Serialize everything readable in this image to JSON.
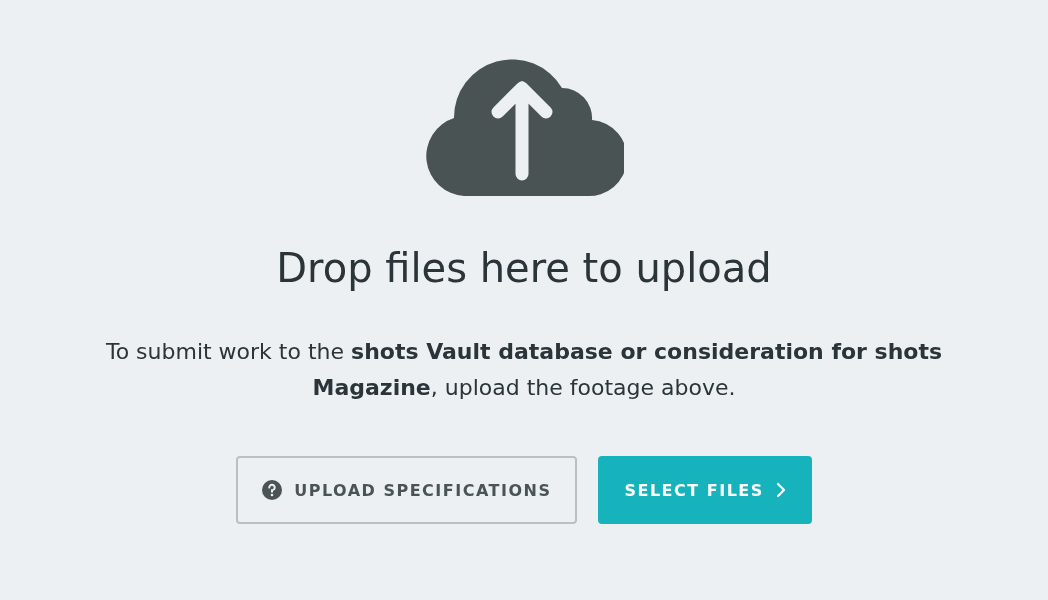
{
  "heading": "Drop files here to upload",
  "description": "To submit work to the **shots Vault database or consideration for shots Magazine**, upload the footage above.",
  "buttons": [
    {
      "kind": "secondary",
      "label": "UPLOAD SPECIFICATIONS"
    },
    {
      "kind": "primary",
      "label": "SELECT FILES"
    }
  ]
}
